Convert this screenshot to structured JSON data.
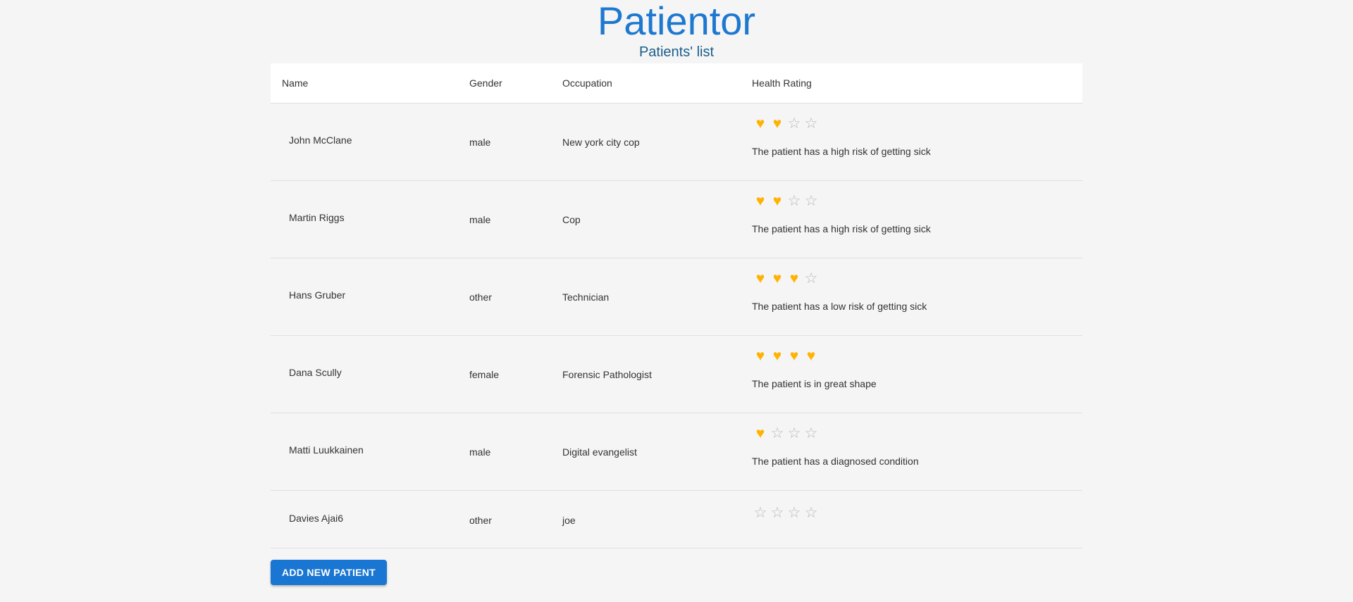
{
  "app": {
    "title": "Patientor",
    "subtitle": "Patients' list"
  },
  "table": {
    "headers": [
      "Name",
      "Gender",
      "Occupation",
      "Health Rating"
    ],
    "rows": [
      {
        "name": "John McClane",
        "gender": "male",
        "occupation": "New york city cop",
        "rating": 2,
        "rating_max": 4,
        "risk": "The patient has a high risk of getting sick"
      },
      {
        "name": "Martin Riggs",
        "gender": "male",
        "occupation": "Cop",
        "rating": 2,
        "rating_max": 4,
        "risk": "The patient has a high risk of getting sick"
      },
      {
        "name": "Hans Gruber",
        "gender": "other",
        "occupation": "Technician",
        "rating": 3,
        "rating_max": 4,
        "risk": "The patient has a low risk of getting sick"
      },
      {
        "name": "Dana Scully",
        "gender": "female",
        "occupation": "Forensic Pathologist",
        "rating": 4,
        "rating_max": 4,
        "risk": "The patient is in great shape"
      },
      {
        "name": "Matti Luukkainen",
        "gender": "male",
        "occupation": "Digital evangelist",
        "rating": 1,
        "rating_max": 4,
        "risk": "The patient has a diagnosed condition"
      },
      {
        "name": "Davies Ajai6",
        "gender": "other",
        "occupation": "joe",
        "rating": 0,
        "rating_max": 4,
        "risk": ""
      }
    ]
  },
  "icons": {
    "filled": "heart-icon",
    "empty": "star-outline-icon"
  },
  "colors": {
    "title": "#1e78d0",
    "heart": "#ffb300",
    "button": "#1976d2"
  },
  "actions": {
    "add_patient_label": "ADD NEW PATIENT"
  }
}
